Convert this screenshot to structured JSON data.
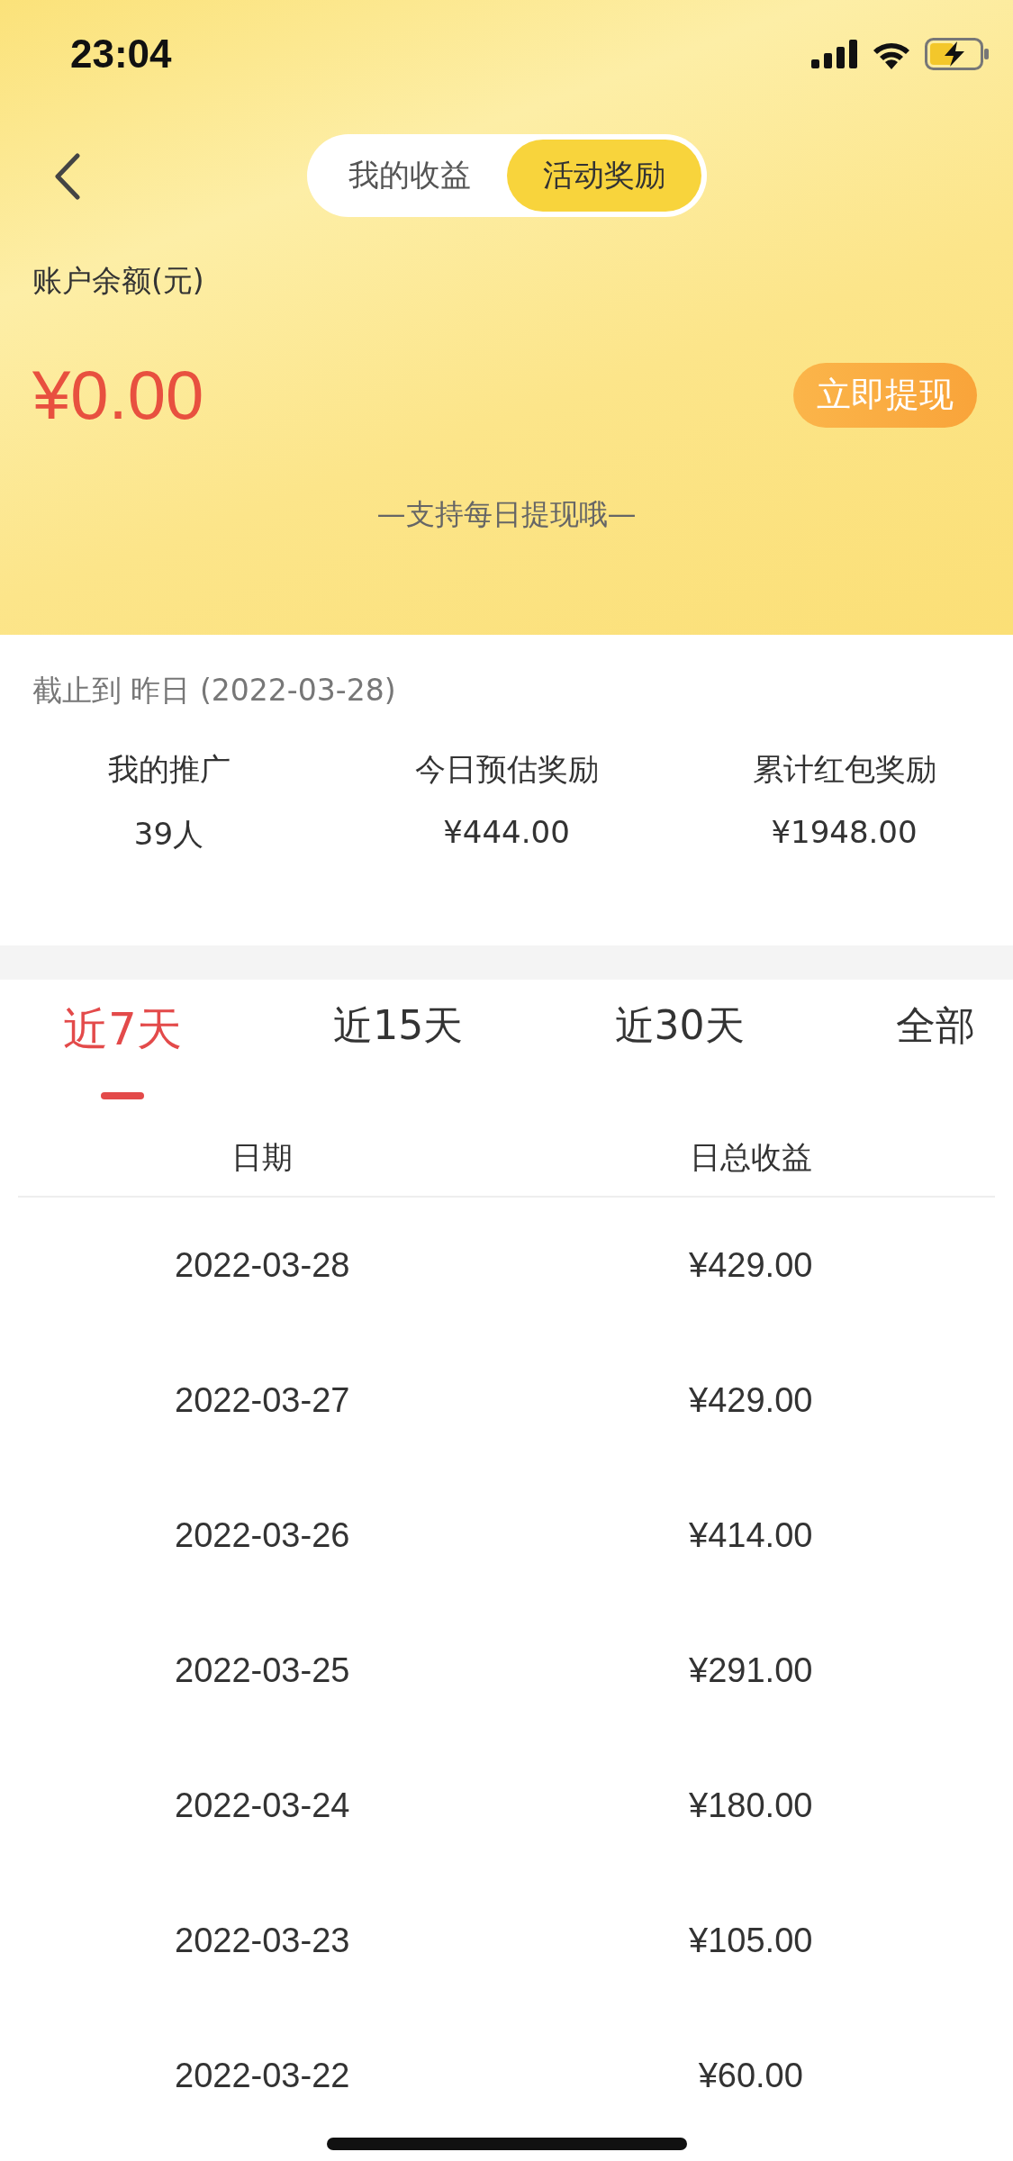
{
  "status_bar": {
    "time": "23:04"
  },
  "header": {
    "segments": [
      {
        "label": "我的收益",
        "selected": false
      },
      {
        "label": "活动奖励",
        "selected": true
      }
    ]
  },
  "balance": {
    "label": "账户余额(元)",
    "amount": "¥0.00",
    "withdraw_button": "立即提现",
    "note": "—支持每日提现哦—"
  },
  "summary": {
    "as_of": "截止到 昨日 (2022-03-28)",
    "stats": [
      {
        "label": "我的推广",
        "value": "39人"
      },
      {
        "label": "今日预估奖励",
        "value": "¥444.00"
      },
      {
        "label": "累计红包奖励",
        "value": "¥1948.00"
      }
    ]
  },
  "range_tabs": [
    {
      "label": "近7天",
      "selected": true
    },
    {
      "label": "近15天",
      "selected": false
    },
    {
      "label": "近30天",
      "selected": false
    },
    {
      "label": "全部",
      "selected": false
    }
  ],
  "table": {
    "columns": [
      "日期",
      "日总收益"
    ],
    "rows": [
      [
        "2022-03-28",
        "¥429.00"
      ],
      [
        "2022-03-27",
        "¥429.00"
      ],
      [
        "2022-03-26",
        "¥414.00"
      ],
      [
        "2022-03-25",
        "¥291.00"
      ],
      [
        "2022-03-24",
        "¥180.00"
      ],
      [
        "2022-03-23",
        "¥105.00"
      ],
      [
        "2022-03-22",
        "¥60.00"
      ]
    ]
  }
}
